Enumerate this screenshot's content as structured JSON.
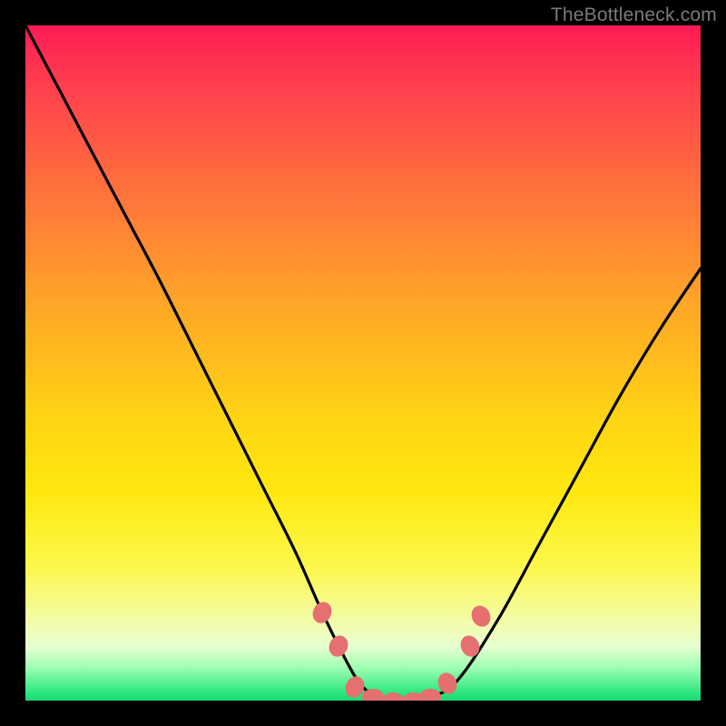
{
  "watermark": "TheBottleneck.com",
  "colors": {
    "frame": "#000000",
    "curve": "#000000",
    "dot": "#e66f70"
  },
  "chart_data": {
    "type": "line",
    "title": "",
    "xlabel": "",
    "ylabel": "",
    "xlim": [
      0,
      100
    ],
    "ylim": [
      0,
      100
    ],
    "grid": false,
    "legend": false,
    "series": [
      {
        "name": "bottleneck-curve",
        "x": [
          0,
          5,
          10,
          15,
          20,
          25,
          30,
          35,
          40,
          44,
          48,
          50,
          52,
          54,
          56,
          58,
          60,
          64,
          70,
          76,
          82,
          88,
          94,
          100
        ],
        "y": [
          100,
          90.5,
          81,
          71.5,
          62,
          52,
          42,
          32,
          22,
          13,
          5,
          2,
          0.5,
          0,
          0,
          0,
          0.5,
          3,
          12,
          23,
          34,
          45,
          55,
          64
        ]
      }
    ],
    "markers": [
      {
        "name": "left-upper-dot",
        "x": 44.0,
        "y": 13.0
      },
      {
        "name": "left-mid-dot",
        "x": 46.4,
        "y": 8.0
      },
      {
        "name": "left-lower-dot",
        "x": 48.8,
        "y": 2.0
      },
      {
        "name": "valley-dot-1",
        "x": 51.5,
        "y": 0.5
      },
      {
        "name": "valley-dot-2",
        "x": 54.5,
        "y": 0.0
      },
      {
        "name": "valley-dot-3",
        "x": 57.5,
        "y": 0.0
      },
      {
        "name": "valley-dot-4",
        "x": 60.0,
        "y": 0.5
      },
      {
        "name": "right-lower-dot",
        "x": 62.5,
        "y": 2.5
      },
      {
        "name": "right-mid-dot",
        "x": 65.8,
        "y": 8.0
      },
      {
        "name": "right-upper-dot",
        "x": 67.5,
        "y": 12.5
      }
    ]
  }
}
